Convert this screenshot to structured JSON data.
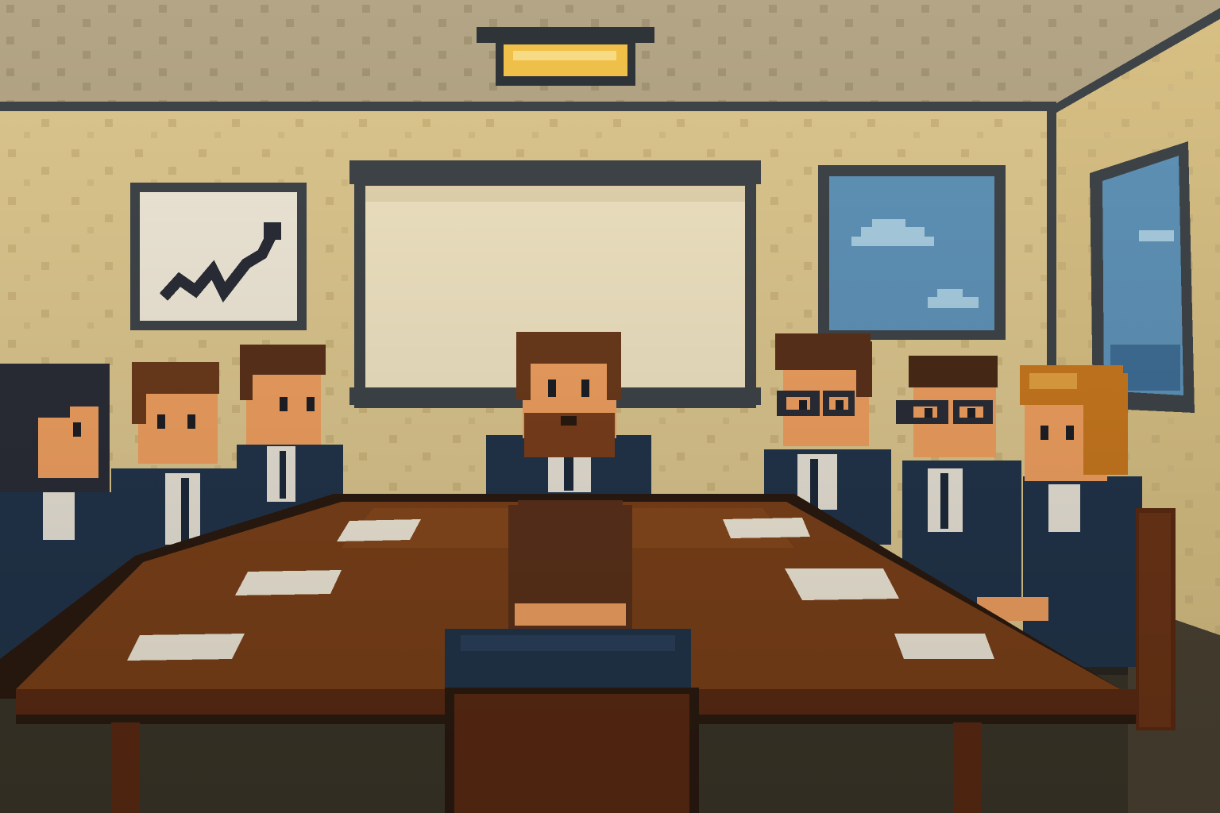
{
  "scene": {
    "type": "pixel-art",
    "setting": "boardroom",
    "elements": [
      "ceiling-light",
      "line-chart-poster",
      "projector-screen",
      "window-with-clouds",
      "side-window",
      "conference-table",
      "papers",
      "empty-chair"
    ]
  },
  "people": [
    {
      "id": "woman-dark-hair-left",
      "hair": "#2a2d36"
    },
    {
      "id": "man-brown-hair-left",
      "hair": "#6b3a1c"
    },
    {
      "id": "man-brown-hair-back-left",
      "hair": "#5a311a"
    },
    {
      "id": "bearded-leader-center",
      "hair": "#6b3a1c"
    },
    {
      "id": "man-glasses-right",
      "hair": "#5a311a"
    },
    {
      "id": "man-glasses-far-right",
      "hair": "#4a2a18"
    },
    {
      "id": "woman-ginger-hair-right",
      "hair": "#c8781e"
    },
    {
      "id": "person-back-of-head-front",
      "hair": "#5a311a"
    }
  ],
  "palette": {
    "wall": "#dcc68e",
    "ceiling": "#b3a585",
    "frame": "#3f4448",
    "table": "#7a4019",
    "suit": "#22344a",
    "skin": "#f0a060",
    "sky": "#5f93b8",
    "screen": "#efe3c2",
    "light": "#f2c24a"
  }
}
